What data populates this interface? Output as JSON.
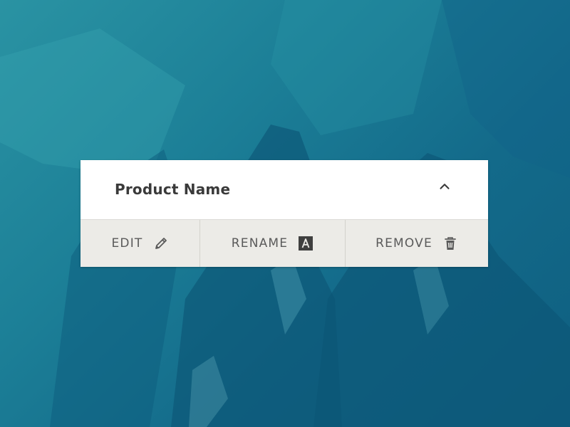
{
  "card": {
    "title": "Product Name",
    "collapse_icon": "chevron-up-icon"
  },
  "actions": [
    {
      "label": "EDIT",
      "icon": "pencil-icon"
    },
    {
      "label": "RENAME",
      "icon": "rename-icon"
    },
    {
      "label": "REMOVE",
      "icon": "trash-icon"
    }
  ],
  "colors": {
    "background_teal": "#1c7f97",
    "card_header": "#ffffff",
    "actions_bar": "#ecebe7",
    "title_text": "#3a3a3a",
    "action_text": "#5a5a5a"
  }
}
